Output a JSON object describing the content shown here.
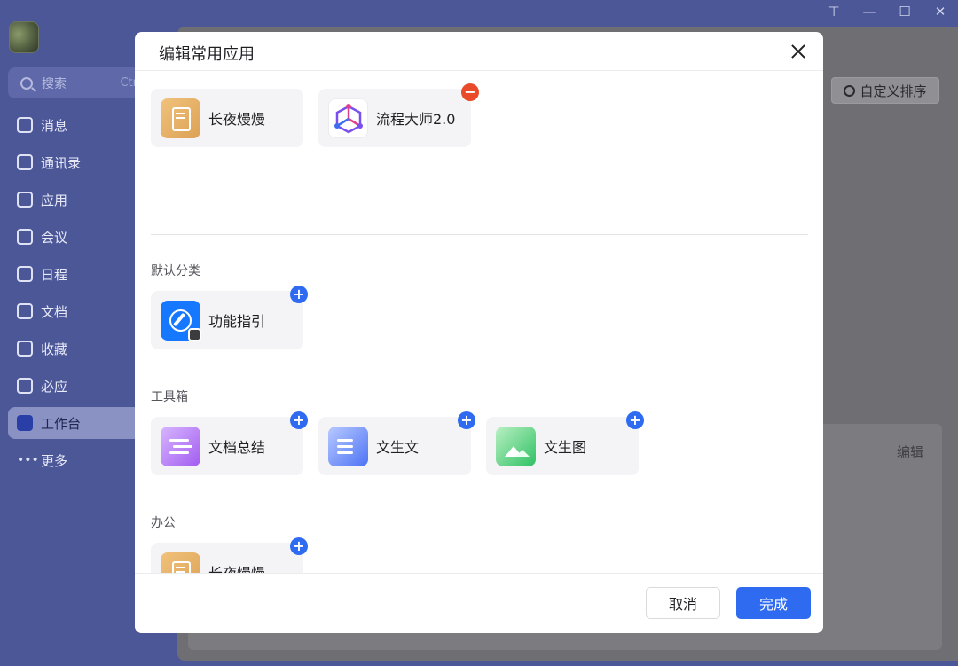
{
  "sidebar": {
    "search": {
      "placeholder": "搜索",
      "shortcut": "Ctr"
    },
    "items": [
      {
        "label": "消息",
        "icon": "message-icon"
      },
      {
        "label": "通讯录",
        "icon": "contacts-icon"
      },
      {
        "label": "应用",
        "icon": "apps-icon"
      },
      {
        "label": "会议",
        "icon": "meeting-icon"
      },
      {
        "label": "日程",
        "icon": "calendar-icon"
      },
      {
        "label": "文档",
        "icon": "document-icon"
      },
      {
        "label": "收藏",
        "icon": "favorites-icon"
      },
      {
        "label": "必应",
        "icon": "lightning-icon"
      },
      {
        "label": "工作台",
        "icon": "workbench-icon",
        "active": true
      },
      {
        "label": "更多",
        "icon": "more-icon"
      }
    ]
  },
  "titlebar": {
    "pin": "⊤",
    "minimize": "—",
    "maximize": "☐",
    "close": "✕"
  },
  "background": {
    "sort_label": "自定义排序",
    "edit_label": "编辑"
  },
  "dialog": {
    "title": "编辑常用应用",
    "favorites": [
      {
        "label": "长夜熳熳",
        "icon": "note-icon"
      },
      {
        "label": "流程大师2.0",
        "icon": "flow-master-icon"
      }
    ],
    "sections": [
      {
        "title": "默认分类",
        "apps": [
          {
            "label": "功能指引",
            "icon": "compass-icon"
          }
        ]
      },
      {
        "title": "工具箱",
        "apps": [
          {
            "label": "文档总结",
            "icon": "doc-summary-icon"
          },
          {
            "label": "文生文",
            "icon": "text-gen-icon"
          },
          {
            "label": "文生图",
            "icon": "image-gen-icon"
          }
        ]
      },
      {
        "title": "办公",
        "apps": [
          {
            "label": "长夜熳熳",
            "icon": "note-icon"
          }
        ]
      }
    ],
    "add_symbol": "+",
    "remove_symbol": "−",
    "cancel_label": "取消",
    "done_label": "完成"
  },
  "colors": {
    "primary": "#2e6bf0",
    "remove": "#e84a2a",
    "sidebar": "#4c5797"
  }
}
